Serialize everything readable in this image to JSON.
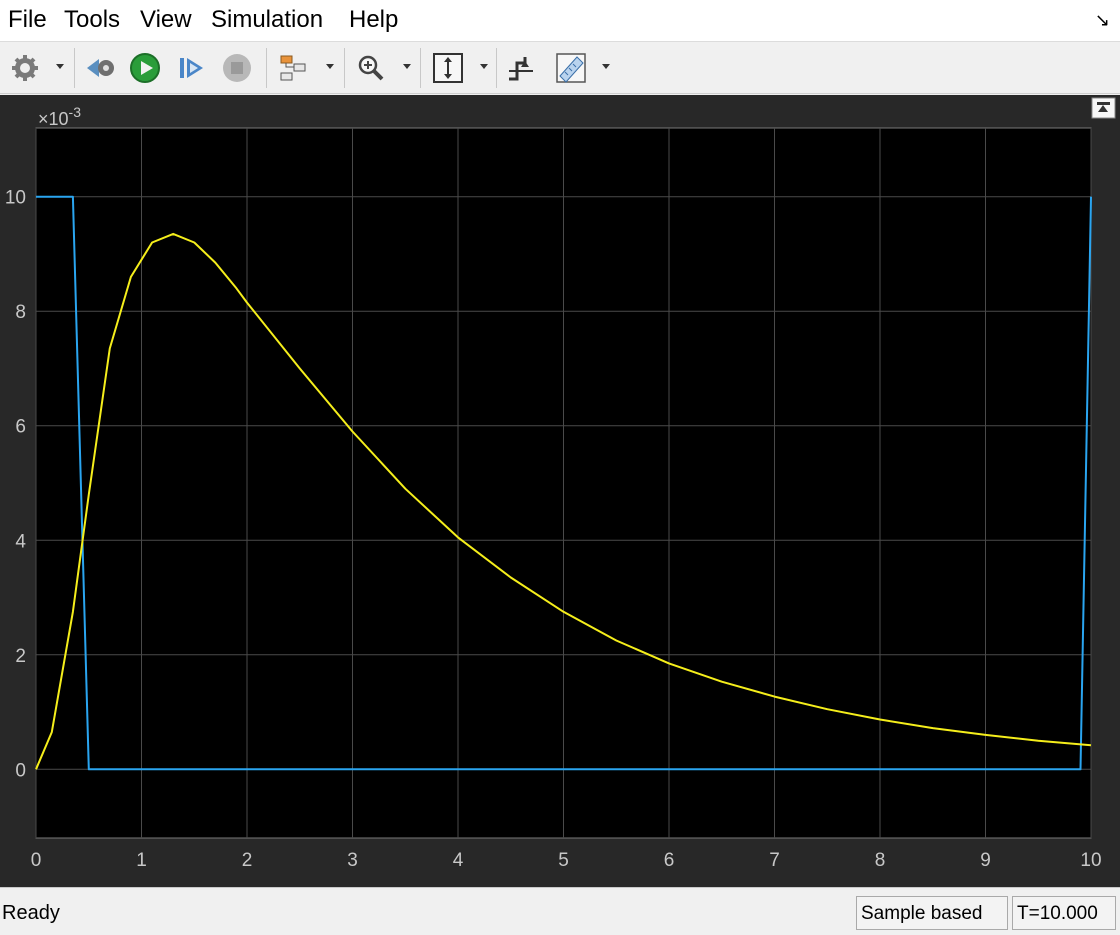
{
  "menu": {
    "items": [
      "File",
      "Tools",
      "View",
      "Simulation",
      "Help"
    ]
  },
  "toolbar": {
    "buttons": [
      {
        "icon": "gear-icon",
        "dropdown": true
      },
      {
        "icon": "step-back-icon",
        "dropdown": false
      },
      {
        "icon": "run-icon",
        "dropdown": false
      },
      {
        "icon": "step-forward-icon",
        "dropdown": false
      },
      {
        "icon": "stop-icon",
        "dropdown": false
      },
      {
        "icon": "highlight-icon",
        "dropdown": true
      },
      {
        "icon": "zoom-in-icon",
        "dropdown": true
      },
      {
        "icon": "autoscale-icon",
        "dropdown": true
      },
      {
        "icon": "triggers-icon",
        "dropdown": false
      },
      {
        "icon": "cursor-measure-icon",
        "dropdown": true
      }
    ]
  },
  "colors": {
    "plot_background": "#000000",
    "panel_background": "#282828",
    "grid": "#4a4a4a",
    "axis_text": "#c8c8c8",
    "series_blue": "#2aa5f0",
    "series_yellow": "#f5ee1b"
  },
  "chart_data": {
    "type": "line",
    "title": "",
    "xlabel": "",
    "ylabel": "",
    "exponent_label": "×10",
    "exponent_power": "-3",
    "xlim": [
      0,
      10
    ],
    "ylim": [
      -1.2,
      11.2
    ],
    "xticks": [
      "0",
      "1",
      "2",
      "3",
      "4",
      "5",
      "6",
      "7",
      "8",
      "9",
      "10"
    ],
    "yticks": [
      "0",
      "2",
      "4",
      "6",
      "8",
      "10"
    ],
    "grid": true,
    "series": [
      {
        "color": "#2aa5f0",
        "x": [
          0,
          0.35,
          0.5,
          9.9,
          10
        ],
        "y": [
          10,
          10,
          0,
          0,
          10
        ]
      },
      {
        "color": "#f5ee1b",
        "x": [
          0,
          0.15,
          0.35,
          0.5,
          0.7,
          0.9,
          1.1,
          1.3,
          1.5,
          1.7,
          1.9,
          2.0,
          2.5,
          3.0,
          3.5,
          4.0,
          4.5,
          5.0,
          5.5,
          6.0,
          6.5,
          7.0,
          7.5,
          8.0,
          8.5,
          9.0,
          9.5,
          10.0
        ],
        "y": [
          0,
          0.65,
          2.75,
          4.8,
          7.35,
          8.6,
          9.2,
          9.35,
          9.2,
          8.85,
          8.4,
          8.15,
          7.0,
          5.9,
          4.9,
          4.05,
          3.35,
          2.75,
          2.25,
          1.85,
          1.53,
          1.27,
          1.05,
          0.87,
          0.72,
          0.6,
          0.5,
          0.42
        ]
      }
    ]
  },
  "status": {
    "ready": "Ready",
    "mode": "Sample based",
    "time": "T=10.000"
  }
}
